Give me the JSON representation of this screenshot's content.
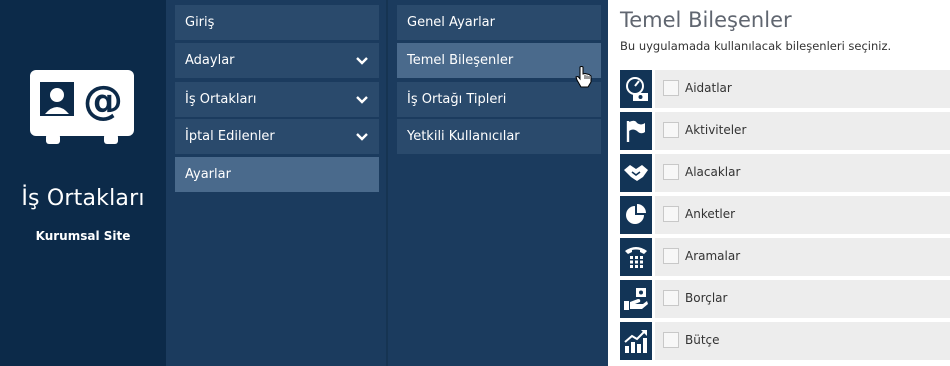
{
  "brand": {
    "title": "İş Ortakları",
    "subtitle": "Kurumsal Site"
  },
  "menu1": [
    {
      "label": "Giriş",
      "has_chevron": false,
      "active": false
    },
    {
      "label": "Adaylar",
      "has_chevron": true,
      "active": false
    },
    {
      "label": "İş Ortakları",
      "has_chevron": true,
      "active": false
    },
    {
      "label": "İptal Edilenler",
      "has_chevron": true,
      "active": false
    },
    {
      "label": "Ayarlar",
      "has_chevron": false,
      "active": true
    }
  ],
  "menu2": [
    {
      "label": "Genel Ayarlar",
      "active": false
    },
    {
      "label": "Temel Bileşenler",
      "active": true
    },
    {
      "label": "İş Ortağı Tipleri",
      "active": false
    },
    {
      "label": "Yetkili Kullanıcılar",
      "active": false
    }
  ],
  "content": {
    "title": "Temel Bileşenler",
    "subtitle": "Bu uygulamada kullanılacak bileşenleri seçiniz.",
    "components": [
      {
        "label": "Aidatlar",
        "icon": "dues-icon",
        "checked": false
      },
      {
        "label": "Aktiviteler",
        "icon": "flag-icon",
        "checked": false
      },
      {
        "label": "Alacaklar",
        "icon": "handshake-icon",
        "checked": false
      },
      {
        "label": "Anketler",
        "icon": "pie-chart-icon",
        "checked": false
      },
      {
        "label": "Aramalar",
        "icon": "phone-icon",
        "checked": false
      },
      {
        "label": "Borçlar",
        "icon": "payment-icon",
        "checked": false
      },
      {
        "label": "Bütçe",
        "icon": "growth-chart-icon",
        "checked": false
      }
    ]
  },
  "colors": {
    "brand_bg": "#0c2a49",
    "menu_bg": "#1b3b5e",
    "item_bg": "#2a4a6c",
    "item_active": "#4a6a8c"
  }
}
